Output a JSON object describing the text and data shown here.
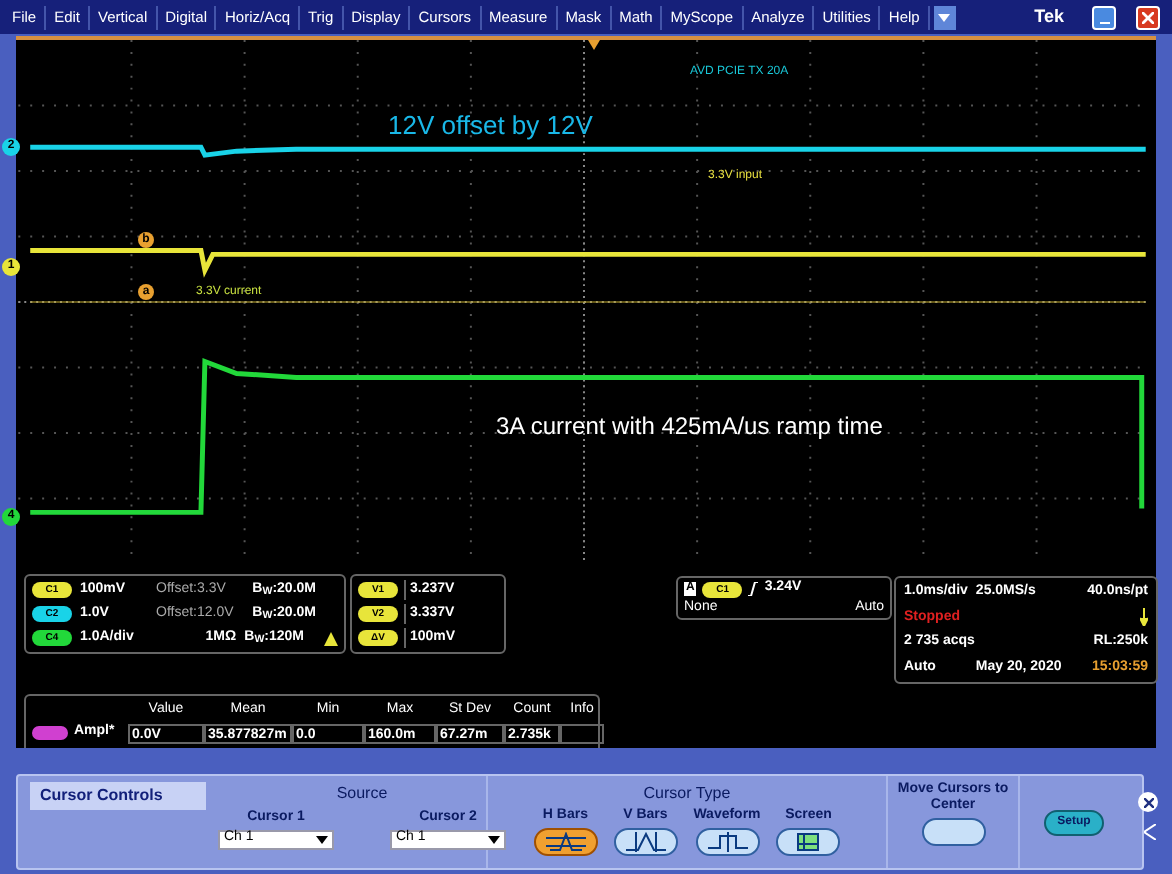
{
  "menu": {
    "items": [
      "File",
      "Edit",
      "Vertical",
      "Digital",
      "Horiz/Acq",
      "Trig",
      "Display",
      "Cursors",
      "Measure",
      "Mask",
      "Math",
      "MyScope",
      "Analyze",
      "Utilities",
      "Help"
    ],
    "brand": "Tek"
  },
  "display": {
    "annotations": [
      {
        "text": "AVD PCIE TX 20A",
        "color": "#19c8d8"
      },
      {
        "text": "12V offset by 12V",
        "color": "#19b8e8"
      },
      {
        "text": "3.3V input",
        "color": "#e8e040"
      },
      {
        "text": "3.3V current",
        "color": "#c8e040"
      },
      {
        "text": "3A current with 425mA/us ramp time",
        "color": "#ffffff"
      }
    ],
    "channel_markers": [
      {
        "label": "2",
        "color": "#19d3e8"
      },
      {
        "label": "1",
        "color": "#e8e53a"
      },
      {
        "label": "4",
        "color": "#22d83a"
      }
    ],
    "cursor_markers": [
      {
        "label": "b"
      },
      {
        "label": "a"
      }
    ]
  },
  "channels": [
    {
      "badge": "C1",
      "color": "#e8e53a",
      "scale": "100mV",
      "offset": "Offset:3.3V",
      "bandwidth": "B$_{W}$:20.0M"
    },
    {
      "badge": "C2",
      "color": "#19d3e8",
      "scale": "1.0V",
      "offset": "Offset:12.0V",
      "bandwidth": "B$_{W}$:20.0M"
    },
    {
      "badge": "C4",
      "color": "#22d83a",
      "scale": "1.0A/div",
      "termination": "1MΩ",
      "bandwidth": "B$_{W}$:120M",
      "warning": true
    }
  ],
  "cursor_readouts": [
    {
      "badge": "V1",
      "value": "3.237V"
    },
    {
      "badge": "V2",
      "value": "3.337V"
    },
    {
      "badge": "ΔV",
      "value": "100mV"
    }
  ],
  "trigger": {
    "mode_badge": "A",
    "source": "C1",
    "level": "3.24V",
    "coupling": "None",
    "sweep": "Auto"
  },
  "acquisition": {
    "timebase": "1.0ms/div",
    "sample_rate": "25.0MS/s",
    "resolution": "40.0ns/pt",
    "state": "Stopped",
    "acqs": "2 735 acqs",
    "record_length": "RL:250k",
    "mode": "Auto",
    "date": "May 20, 2020",
    "time": "15:03:59"
  },
  "measurements": {
    "columns": [
      "Value",
      "Mean",
      "Min",
      "Max",
      "St Dev",
      "Count",
      "Info"
    ],
    "rows": [
      {
        "name": "Ampl*",
        "values": [
          "0.0V",
          "35.877827m",
          "0.0",
          "160.0m",
          "67.27m",
          "2.735k"
        ]
      }
    ]
  },
  "cursor_controls": {
    "title": "Cursor Controls",
    "source_label": "Source",
    "sources": [
      {
        "label": "Cursor 1",
        "value": "Ch 1"
      },
      {
        "label": "Cursor 2",
        "value": "Ch 1"
      }
    ],
    "type_label": "Cursor Type",
    "types": [
      {
        "label": "H Bars",
        "kind": "hbars",
        "selected": true
      },
      {
        "label": "V Bars",
        "kind": "vbars",
        "selected": false
      },
      {
        "label": "Waveform",
        "kind": "waveform",
        "selected": false
      },
      {
        "label": "Screen",
        "kind": "screen",
        "selected": false
      }
    ],
    "move_label": "Move Cursors to Center",
    "setup": "Setup"
  }
}
